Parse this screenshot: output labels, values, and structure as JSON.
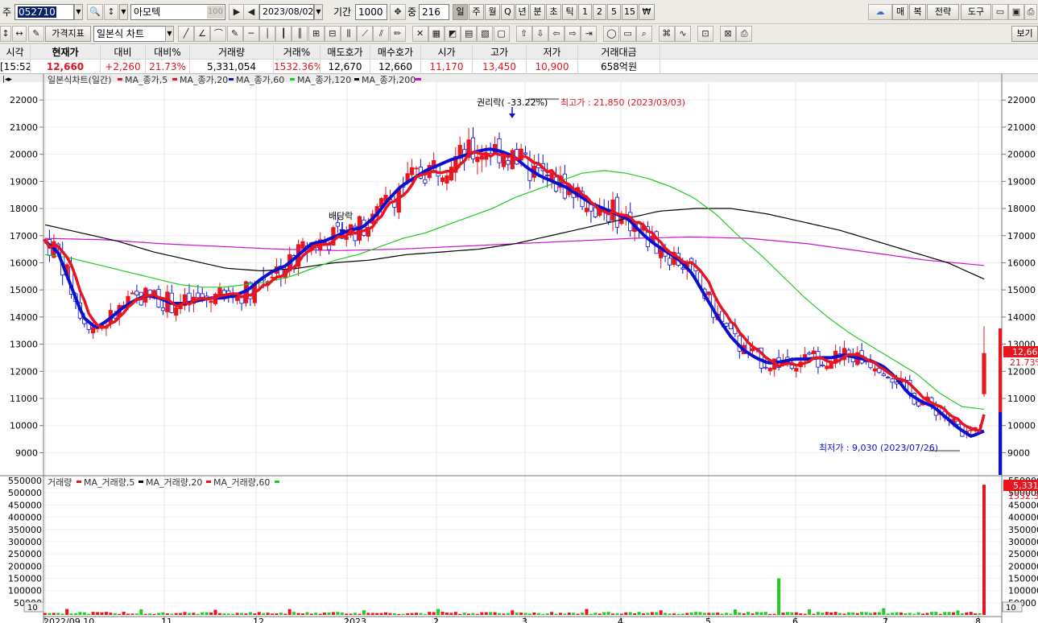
{
  "toolbar": {
    "market_label": "주",
    "code": "052710",
    "stock_name": "아모텍",
    "name_box_hint": "100",
    "date": "2023/08/02",
    "period_label": "기간",
    "period_value": "1000",
    "count_label": "중",
    "count_value": "216",
    "timeframes": [
      "일",
      "주",
      "월",
      "Q",
      "년",
      "분",
      "초",
      "틱",
      "1",
      "2",
      "5",
      "15",
      "₩"
    ],
    "active_timeframe": "일",
    "right_buttons": [
      "매",
      "복",
      "전략",
      "도구"
    ],
    "indicator_button": "가격지표",
    "chart_type": "일본식 차트",
    "view_button": "보기"
  },
  "quote": {
    "headers": [
      "시각",
      "현재가",
      "대비",
      "대비%",
      "거래량",
      "거래%",
      "매도호가",
      "매수호가",
      "시가",
      "고가",
      "저가",
      "거래대금"
    ],
    "values": [
      "[15:52]",
      "12,660",
      "+2,260",
      "21.73%",
      "5,331,054",
      "1532.36%",
      "12,670",
      "12,660",
      "11,170",
      "13,450",
      "10,900",
      "658억원"
    ]
  },
  "colors": {
    "up": "#e8141e",
    "down": "#1010d0",
    "ma5": "#e8141e",
    "ma20": "#0a10d0",
    "ma60": "#22cc22",
    "ma120": "#000000",
    "ma200": "#cc10cc"
  },
  "chart_data": {
    "type": "candlestick",
    "price_panel": {
      "legend": [
        "일본식차트(일간)",
        "MA_종가,5",
        "MA_종가,20",
        "MA_종가,60",
        "MA_종가,120",
        "MA_종가,200"
      ],
      "ylim": [
        8300,
        22600
      ],
      "yticks": [
        "22000",
        "21000",
        "20000",
        "19000",
        "18000",
        "17000",
        "16000",
        "15000",
        "14000",
        "13000",
        "12000",
        "11000",
        "10000",
        "9000"
      ],
      "annotations": {
        "ex_rights": "권리락( -33.22%)",
        "dividend": "배당락",
        "high": "최고가 : 21,850 (2023/03/03)",
        "low": "최저가 : 9,030 (2023/07/26)"
      },
      "last_price_label": "12,660",
      "last_change_label": "21.73%",
      "series": [
        {
          "name": "MA_종가,20",
          "values": [
            16800,
            16400,
            15200,
            14000,
            13600,
            13900,
            14300,
            14600,
            14800,
            14700,
            14500,
            14500,
            14600,
            14700,
            14700,
            14800,
            15000,
            15400,
            15700,
            15900,
            16300,
            16700,
            16800,
            17000,
            17200,
            17300,
            17700,
            18300,
            18800,
            19100,
            19400,
            19600,
            19800,
            19950,
            20100,
            20200,
            20100,
            19900,
            19500,
            19200,
            19000,
            18800,
            18500,
            18200,
            18000,
            17800,
            17600,
            17100,
            16700,
            16400,
            16100,
            15600,
            14800,
            14000,
            13300,
            12800,
            12500,
            12300,
            12350,
            12450,
            12450,
            12500,
            12500,
            12600,
            12500,
            12400,
            12200,
            11800,
            11200,
            10900,
            10700,
            10300,
            9900,
            9600,
            9800
          ]
        },
        {
          "name": "MA_종가,60",
          "values": [
            16300,
            16200,
            16000,
            15800,
            15600,
            15400,
            15200,
            15100,
            15100,
            15200,
            15300,
            15500,
            15800,
            16100,
            16300,
            16600,
            16900,
            17100,
            17400,
            17700,
            18000,
            18400,
            18700,
            19000,
            19300,
            19400,
            19300,
            19100,
            18800,
            18400,
            17800,
            17000,
            16300,
            15500,
            14700,
            14000,
            13400,
            12900,
            12400,
            11900,
            11200,
            10700,
            10600
          ]
        },
        {
          "name": "MA_종가,120",
          "values": [
            17400,
            17100,
            16800,
            16400,
            16100,
            15800,
            15700,
            15800,
            16000,
            16100,
            16300,
            16400,
            16500,
            16700,
            17000,
            17300,
            17600,
            17900,
            18000,
            18000,
            17800,
            17500,
            17200,
            16800,
            16400,
            16000,
            15400
          ]
        },
        {
          "name": "MA_종가,200",
          "values": [
            16900,
            16850,
            16700,
            16600,
            16500,
            16450,
            16500,
            16600,
            16700,
            16800,
            16900,
            16950,
            16900,
            16700,
            16400,
            16100,
            15900
          ]
        }
      ]
    },
    "volume_panel": {
      "legend": [
        "거래량",
        "MA_거래량,5",
        "MA_거래량,20",
        "MA_거래량,60"
      ],
      "ylim": [
        0,
        560000
      ],
      "yticks": [
        "550000",
        "500000",
        "450000",
        "400000",
        "350000",
        "300000",
        "250000",
        "200000",
        "150000",
        "100000",
        "50000"
      ],
      "last_volume_label": "5,331",
      "last_ratio_label": "1532.36",
      "scale_box": "10"
    },
    "x_labels": [
      "2022/09 10",
      "11",
      "12",
      "2023",
      "2",
      "3",
      "4",
      "5",
      "6",
      "7",
      "8"
    ]
  }
}
